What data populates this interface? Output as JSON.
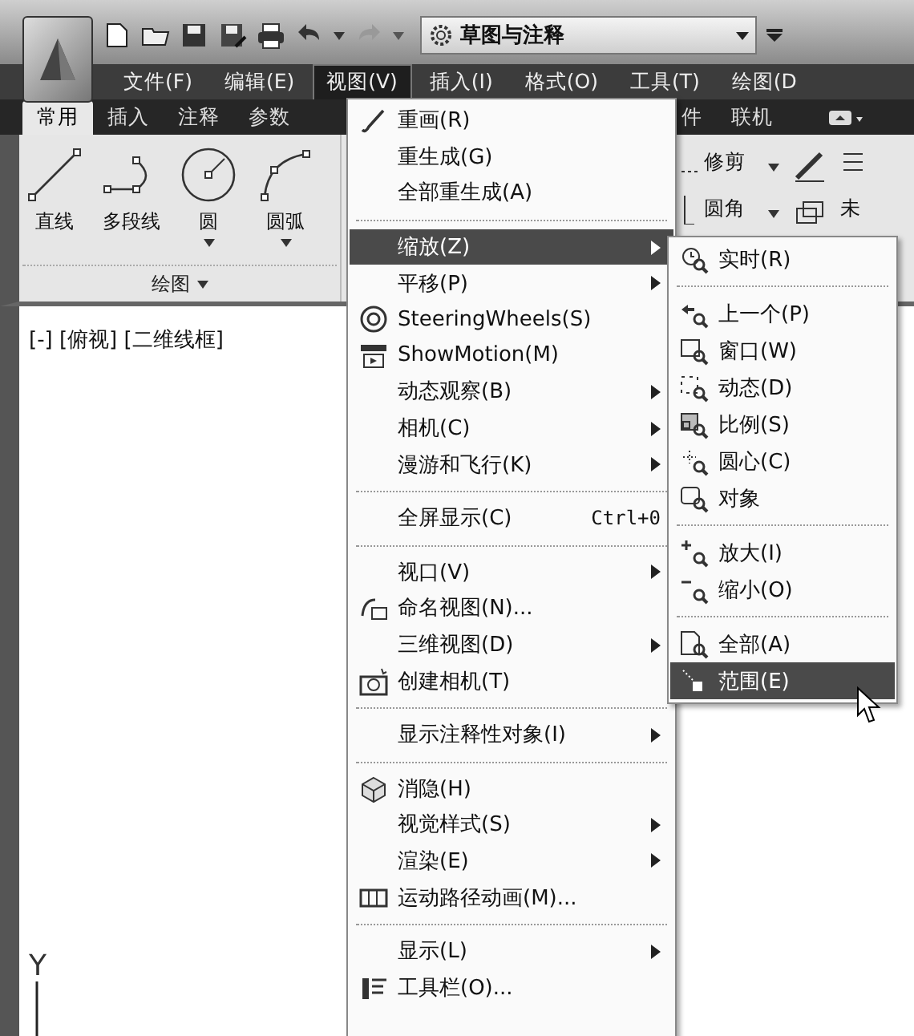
{
  "quick_access": {
    "workspace": "草图与注释"
  },
  "menu_bar": [
    {
      "label": "文件(F)",
      "selected": false
    },
    {
      "label": "编辑(E)",
      "selected": false
    },
    {
      "label": "视图(V)",
      "selected": true
    },
    {
      "label": "插入(I)",
      "selected": false
    },
    {
      "label": "格式(O)",
      "selected": false
    },
    {
      "label": "工具(T)",
      "selected": false
    },
    {
      "label": "绘图(D",
      "selected": false
    }
  ],
  "ribbon_tabs_left": [
    {
      "label": "常用",
      "selected": true
    },
    {
      "label": "插入",
      "selected": false
    },
    {
      "label": "注释",
      "selected": false
    },
    {
      "label": "参数",
      "selected": false
    }
  ],
  "ribbon_tabs_right": [
    {
      "label": "件",
      "selected": false
    },
    {
      "label": "联机",
      "selected": false
    }
  ],
  "draw_panel": {
    "title": "绘图",
    "tools": [
      {
        "label": "直线",
        "has_dropdown": false
      },
      {
        "label": "多段线",
        "has_dropdown": false
      },
      {
        "label": "圆",
        "has_dropdown": true
      },
      {
        "label": "圆弧",
        "has_dropdown": true
      }
    ]
  },
  "modify_panel": {
    "tools": [
      {
        "label": "修剪",
        "has_dropdown": true
      },
      {
        "label": "圆角",
        "has_dropdown": true
      }
    ],
    "cut_label": "未"
  },
  "viewport_label": "[-] [俯视] [二维线框]",
  "ucs_axis": "Y",
  "view_menu": [
    {
      "kind": "item",
      "label": "重画(R)",
      "submenu": false,
      "selected": false
    },
    {
      "kind": "item",
      "label": "重生成(G)",
      "submenu": false,
      "selected": false
    },
    {
      "kind": "item",
      "label": "全部重生成(A)",
      "submenu": false,
      "selected": false
    },
    {
      "kind": "separator"
    },
    {
      "kind": "item",
      "label": "缩放(Z)",
      "submenu": true,
      "selected": true
    },
    {
      "kind": "item",
      "label": "平移(P)",
      "submenu": true,
      "selected": false
    },
    {
      "kind": "item",
      "label": "SteeringWheels(S)",
      "submenu": false,
      "selected": false
    },
    {
      "kind": "item",
      "label": "ShowMotion(M)",
      "submenu": false,
      "selected": false
    },
    {
      "kind": "item",
      "label": "动态观察(B)",
      "submenu": true,
      "selected": false
    },
    {
      "kind": "item",
      "label": "相机(C)",
      "submenu": true,
      "selected": false
    },
    {
      "kind": "item",
      "label": "漫游和飞行(K)",
      "submenu": true,
      "selected": false
    },
    {
      "kind": "separator"
    },
    {
      "kind": "item",
      "label": "全屏显示(C)",
      "shortcut": "Ctrl+0",
      "submenu": false,
      "selected": false
    },
    {
      "kind": "separator"
    },
    {
      "kind": "item",
      "label": "视口(V)",
      "submenu": true,
      "selected": false
    },
    {
      "kind": "item",
      "label": "命名视图(N)...",
      "submenu": false,
      "selected": false
    },
    {
      "kind": "item",
      "label": "三维视图(D)",
      "submenu": true,
      "selected": false
    },
    {
      "kind": "item",
      "label": "创建相机(T)",
      "submenu": false,
      "selected": false
    },
    {
      "kind": "separator"
    },
    {
      "kind": "item",
      "label": "显示注释性对象(I)",
      "submenu": true,
      "selected": false
    },
    {
      "kind": "separator"
    },
    {
      "kind": "item",
      "label": "消隐(H)",
      "submenu": false,
      "selected": false
    },
    {
      "kind": "item",
      "label": "视觉样式(S)",
      "submenu": true,
      "selected": false
    },
    {
      "kind": "item",
      "label": "渲染(E)",
      "submenu": true,
      "selected": false
    },
    {
      "kind": "item",
      "label": "运动路径动画(M)...",
      "submenu": false,
      "selected": false
    },
    {
      "kind": "separator"
    },
    {
      "kind": "item",
      "label": "显示(L)",
      "submenu": true,
      "selected": false
    },
    {
      "kind": "item",
      "label": "工具栏(O)...",
      "submenu": false,
      "selected": false
    }
  ],
  "zoom_submenu": [
    {
      "kind": "item",
      "label": "实时(R)",
      "selected": false
    },
    {
      "kind": "separator"
    },
    {
      "kind": "item",
      "label": "上一个(P)",
      "selected": false
    },
    {
      "kind": "item",
      "label": "窗口(W)",
      "selected": false
    },
    {
      "kind": "item",
      "label": "动态(D)",
      "selected": false
    },
    {
      "kind": "item",
      "label": "比例(S)",
      "selected": false
    },
    {
      "kind": "item",
      "label": "圆心(C)",
      "selected": false
    },
    {
      "kind": "item",
      "label": "对象",
      "selected": false
    },
    {
      "kind": "separator"
    },
    {
      "kind": "item",
      "label": "放大(I)",
      "selected": false
    },
    {
      "kind": "item",
      "label": "缩小(O)",
      "selected": false
    },
    {
      "kind": "separator"
    },
    {
      "kind": "item",
      "label": "全部(A)",
      "selected": false
    },
    {
      "kind": "item",
      "label": "范围(E)",
      "selected": true
    }
  ]
}
